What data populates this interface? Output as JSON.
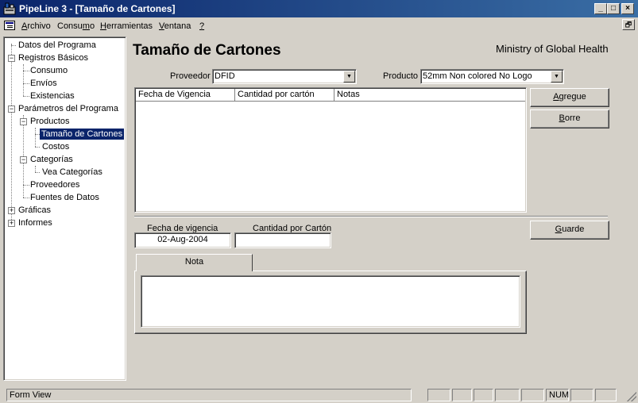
{
  "window": {
    "title": "PipeLine 3 - [Tamaño de Cartones]",
    "minimize": "_",
    "maximize": "□",
    "close": "×",
    "restore": "🗗"
  },
  "menu": [
    {
      "pre": "",
      "u": "A",
      "post": "rchivo"
    },
    {
      "pre": "Consu",
      "u": "m",
      "post": "o"
    },
    {
      "pre": "",
      "u": "H",
      "post": "erramientas"
    },
    {
      "pre": "",
      "u": "V",
      "post": "entana"
    },
    {
      "pre": "",
      "u": "?",
      "post": ""
    }
  ],
  "tree": [
    {
      "label": "Datos del Programa"
    },
    {
      "label": "Registros Básicos",
      "expander": "−"
    },
    {
      "label": "Consumo"
    },
    {
      "label": "Envíos"
    },
    {
      "label": "Existencias"
    },
    {
      "label": "Parámetros del Programa",
      "expander": "−"
    },
    {
      "label": "Productos",
      "expander": "−"
    },
    {
      "label": "Tamaño de Cartones",
      "selected": true
    },
    {
      "label": "Costos"
    },
    {
      "label": "Categorías",
      "expander": "−"
    },
    {
      "label": "Vea Categorías"
    },
    {
      "label": "Proveedores"
    },
    {
      "label": "Fuentes de Datos"
    },
    {
      "label": "Gráficas",
      "expander": "+"
    },
    {
      "label": "Informes",
      "expander": "+"
    }
  ],
  "form": {
    "title": "Tamaño de Cartones",
    "org": "Ministry of Global Health",
    "proveedor_label": "Proveedor",
    "proveedor_value": "DFID",
    "producto_label": "Producto",
    "producto_value": "52mm Non colored No Logo",
    "grid_columns": [
      "Fecha de Vigencia",
      "Cantidad por cartón",
      "Notas"
    ],
    "btn_agregue": {
      "u": "A",
      "rest": "gregue"
    },
    "btn_borre": {
      "u": "B",
      "rest": "orre"
    },
    "btn_guarde": {
      "u": "G",
      "rest": "uarde"
    },
    "fecha_label": "Fecha de vigencia",
    "fecha_value": "02-Aug-2004",
    "cantidad_label": "Cantidad por Cartón",
    "cantidad_value": "",
    "nota_tab": "Nota",
    "nota_value": ""
  },
  "status": {
    "text": "Form View",
    "num": "NUM"
  }
}
